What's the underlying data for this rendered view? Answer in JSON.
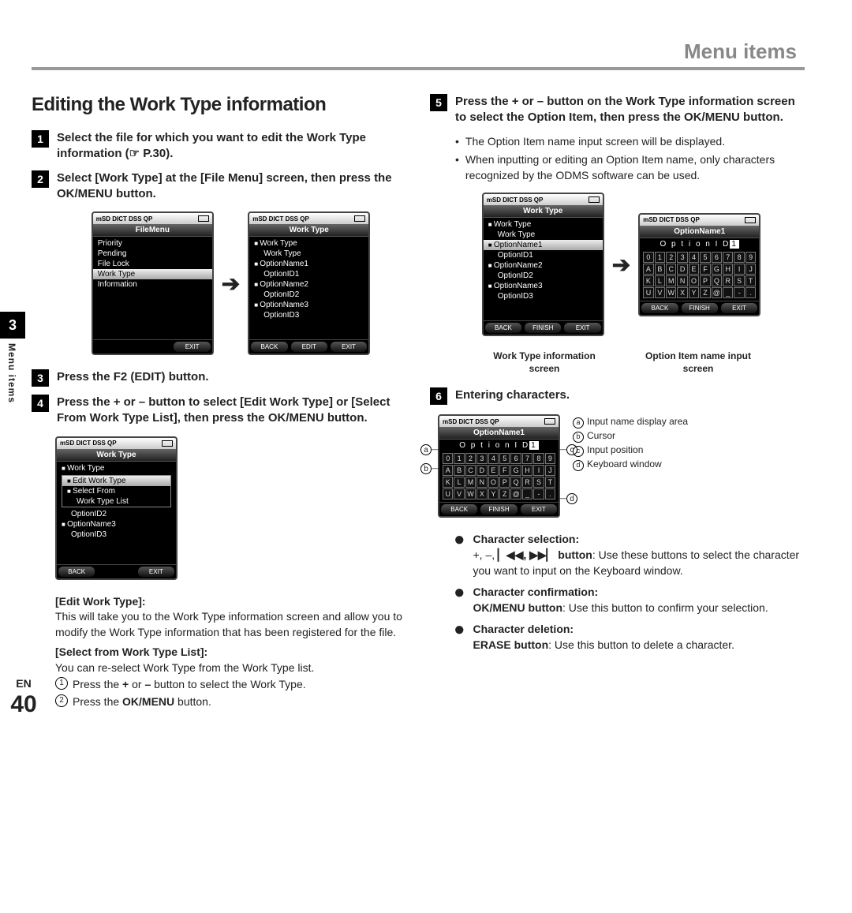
{
  "header": {
    "title": "Menu items"
  },
  "sidebar": {
    "chapter": "3",
    "label": "Menu items"
  },
  "footer": {
    "lang": "EN",
    "page": "40"
  },
  "left": {
    "heading": "Editing the Work Type information",
    "step1": {
      "num": "1",
      "text": "Select the file for which you want to edit the Work Type information (☞ P.30)."
    },
    "step2": {
      "num": "2",
      "text_a": "Select [",
      "text_b": "Work Type",
      "text_c": "] at the [",
      "text_d": "File Menu",
      "text_e": "] screen, then press the ",
      "text_f": "OK/MENU",
      "text_g": " button."
    },
    "screenA": {
      "top": "mSD DICT  DSS  QP",
      "title": "FileMenu",
      "rows": [
        "Priority",
        "Pending",
        "File Lock",
        "Work Type",
        "Information"
      ],
      "sel": 3,
      "foot": [
        "",
        "",
        "EXIT"
      ]
    },
    "screenB": {
      "top": "mSD DICT  DSS  QP",
      "title": "Work Type",
      "rows": [
        {
          "t": "Work Type",
          "sq": true
        },
        {
          "t": "Work Type",
          "ind": true
        },
        {
          "t": "OptionName1",
          "sq": true
        },
        {
          "t": "OptionID1",
          "ind": true
        },
        {
          "t": "OptionName2",
          "sq": true
        },
        {
          "t": "OptionID2",
          "ind": true
        },
        {
          "t": "OptionName3",
          "sq": true
        },
        {
          "t": "OptionID3",
          "ind": true
        }
      ],
      "foot": [
        "BACK",
        "EDIT",
        "EXIT"
      ]
    },
    "step3": {
      "num": "3",
      "text_a": "Press the ",
      "text_b": "F2 (EDIT)",
      "text_c": " button."
    },
    "step4": {
      "num": "4",
      "text_a": "Press the + or – button to select [",
      "text_b": "Edit Work Type",
      "text_c": "] or [",
      "text_d": "Select From Work Type List",
      "text_e": "], then press the ",
      "text_f": "OK/MENU",
      "text_g": " button."
    },
    "screenC": {
      "top": "mSD DICT  DSS  QP",
      "title": "Work Type",
      "rows_pre": [
        {
          "t": "Work Type",
          "sq": true
        }
      ],
      "popup": {
        "rows": [
          "Edit Work Type",
          "Select From",
          "Work Type List"
        ],
        "sel": 0,
        "sq": [
          0,
          1
        ]
      },
      "rows_post": [
        {
          "t": "OptionID2",
          "ind": true
        },
        {
          "t": "OptionName3",
          "sq": true
        },
        {
          "t": "OptionID3",
          "ind": true
        }
      ],
      "foot": [
        "BACK",
        "",
        "EXIT"
      ]
    },
    "desc1": {
      "label": "[Edit Work Type]:",
      "text": "This will take you to the Work Type information screen and allow you to modify the Work Type information that has been registered for the file."
    },
    "desc2": {
      "label": "[Select from Work Type List]:",
      "text": "You can re-select Work Type from the Work Type list.",
      "sub1": {
        "c": "1",
        "a": "Press the ",
        "b": "+",
        "c2": " or ",
        "d": "–",
        "e": " button to select the Work Type."
      },
      "sub2": {
        "c": "2",
        "a": "Press the ",
        "b": "OK/MENU",
        "e": " button."
      }
    }
  },
  "right": {
    "step5": {
      "num": "5",
      "a": "Press the + or – button on the Work Type information screen to select the Option Item, then press the ",
      "b": "OK/MENU",
      "c": " button."
    },
    "notes": [
      "The Option Item name input screen will be displayed.",
      "When inputting or editing an Option Item name, only characters recognized by the ODMS software can be used."
    ],
    "screenD": {
      "top": "mSD DICT  DSS  QP",
      "title": "Work Type",
      "rows": [
        {
          "t": "Work Type",
          "sq": true
        },
        {
          "t": "Work Type",
          "ind": true
        },
        {
          "t": "OptionName1",
          "sq": true,
          "sel": true
        },
        {
          "t": "OptionID1",
          "ind": true
        },
        {
          "t": "OptionName2",
          "sq": true
        },
        {
          "t": "OptionID2",
          "ind": true
        },
        {
          "t": "OptionName3",
          "sq": true
        },
        {
          "t": "OptionID3",
          "ind": true
        }
      ],
      "foot": [
        "BACK",
        "FINISH",
        "EXIT"
      ]
    },
    "screenE": {
      "top": "mSD DICT  DSS  QP",
      "title": "OptionName1",
      "input": "O p t i o n I D",
      "input_cursor": "1",
      "kb": [
        [
          "0",
          "1",
          "2",
          "3",
          "4",
          "5",
          "6",
          "7",
          "8",
          "9"
        ],
        [
          "A",
          "B",
          "C",
          "D",
          "E",
          "F",
          "G",
          "H",
          "I",
          "J"
        ],
        [
          "K",
          "L",
          "M",
          "N",
          "O",
          "P",
          "Q",
          "R",
          "S",
          "T"
        ],
        [
          "U",
          "V",
          "W",
          "X",
          "Y",
          "Z",
          "@",
          "_",
          "-",
          "."
        ]
      ],
      "foot": [
        "BACK",
        "FINISH",
        "EXIT"
      ]
    },
    "captions": [
      "Work Type information screen",
      "Option Item name input screen"
    ],
    "step6": {
      "num": "6",
      "text": "Entering characters."
    },
    "callouts": {
      "a": "Input name display area",
      "b": "Cursor",
      "c": "Input position",
      "d": "Keyboard window"
    },
    "bullets": [
      {
        "head": "Character selection:",
        "body_a": "+, –, ",
        "body_b": "▏◀◀, ▶▶▏ button",
        "body_c": ": Use these buttons to select the character you want to input on the Keyboard window."
      },
      {
        "head": "Character confirmation:",
        "body_a": "",
        "body_b": "OK/MENU button",
        "body_c": ": Use this button to confirm your selection."
      },
      {
        "head": "Character deletion:",
        "body_a": "",
        "body_b": "ERASE button",
        "body_c": ": Use this button to delete a character."
      }
    ]
  }
}
